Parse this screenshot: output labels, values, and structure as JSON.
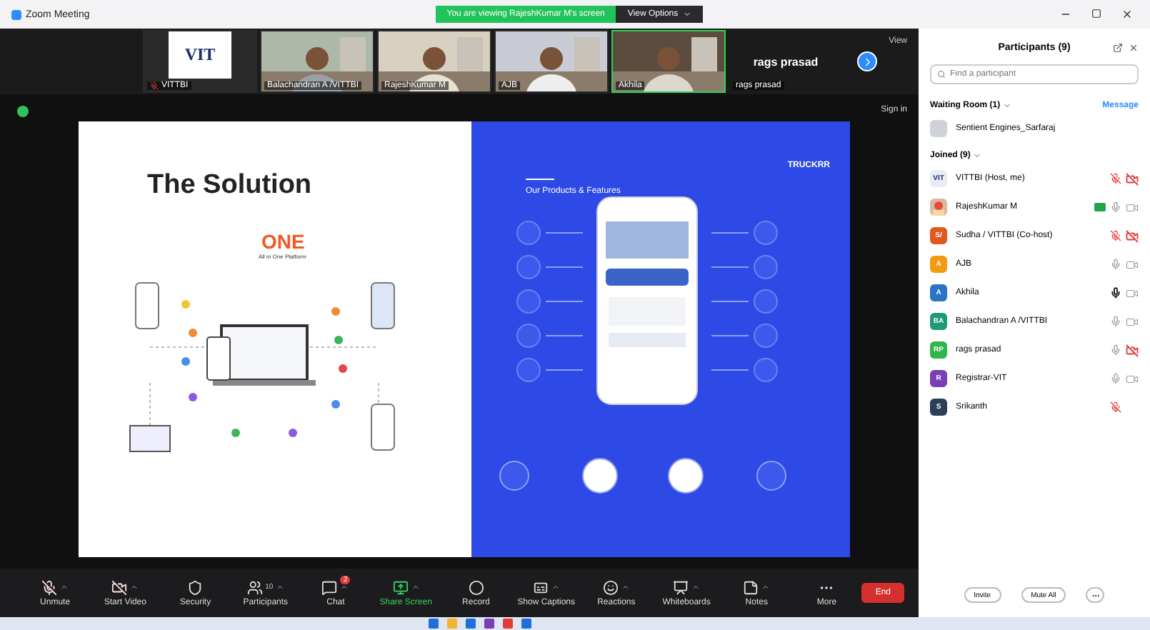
{
  "window": {
    "title": "Zoom Meeting"
  },
  "share_banner": {
    "text": "You are viewing RajeshKumar M's screen",
    "options": "View Options"
  },
  "video_strip": {
    "tiles": [
      {
        "kind": "logo",
        "logo": "VIT",
        "name": "VITTBI",
        "muted": true
      },
      {
        "kind": "video",
        "name": "Balachandran A /VITTBI",
        "muted": false,
        "speaking": false
      },
      {
        "kind": "video",
        "name": "RajeshKumar M",
        "muted": false,
        "speaking": false
      },
      {
        "kind": "video",
        "name": "AJB",
        "muted": false,
        "speaking": false
      },
      {
        "kind": "video",
        "name": "Akhila",
        "muted": false,
        "speaking": true
      },
      {
        "kind": "name",
        "display": "rags prasad",
        "name": "rags prasad",
        "muted": false
      }
    ],
    "view_label": "View"
  },
  "share": {
    "sign_in": "Sign in",
    "slide": {
      "title": "The Solution",
      "one": "ONE",
      "one_sub": "All in One Platform",
      "right_heading": "Our Products & Features",
      "brand": "TRUCKRR"
    }
  },
  "toolbar": {
    "buttons": [
      {
        "kind": "mic",
        "label": "Unmute",
        "off": true
      },
      {
        "kind": "video",
        "label": "Start Video",
        "off": true
      },
      {
        "kind": "security",
        "label": "Security"
      },
      {
        "kind": "participants",
        "label": "Participants",
        "count": "10"
      },
      {
        "kind": "chat",
        "label": "Chat",
        "badge": "2"
      },
      {
        "kind": "share",
        "label": "Share Screen"
      },
      {
        "kind": "record",
        "label": "Record"
      },
      {
        "kind": "captions",
        "label": "Show Captions"
      },
      {
        "kind": "reactions",
        "label": "Reactions"
      },
      {
        "kind": "whiteboards",
        "label": "Whiteboards"
      },
      {
        "kind": "notes",
        "label": "Notes"
      },
      {
        "kind": "more",
        "label": "More"
      }
    ],
    "end": "End"
  },
  "participants_panel": {
    "title": "Participants (9)",
    "search": {
      "placeholder": "Find a participant"
    },
    "waiting_room": {
      "label": "Waiting Room (1)",
      "message": "Message",
      "people": [
        {
          "name": "Sentient Engines_Sarfaraj"
        }
      ]
    },
    "joined": {
      "label": "Joined (9)",
      "people": [
        {
          "name": "VITTBI (Host, me)",
          "kind": "logo",
          "initials": "VIT",
          "color": "#e8ecf5",
          "muted": true,
          "speaking": false,
          "video_shown": true,
          "video_off": true,
          "sharing": false
        },
        {
          "name": "RajeshKumar M",
          "kind": "picture",
          "color": "#d9b8a0",
          "muted": false,
          "speaking": false,
          "video_shown": true,
          "video_off": false,
          "sharing": true
        },
        {
          "name": "Sudha / VITTBI (Co-host)",
          "kind": "initials",
          "initials": "S/",
          "color": "#e0591f",
          "muted": true,
          "speaking": false,
          "video_shown": true,
          "video_off": true,
          "sharing": false
        },
        {
          "name": "AJB",
          "kind": "initials",
          "initials": "A",
          "color": "#f39a12",
          "muted": false,
          "speaking": false,
          "video_shown": true,
          "video_off": false,
          "sharing": false
        },
        {
          "name": "Akhila",
          "kind": "initials",
          "initials": "A",
          "color": "#2a73c5",
          "muted": false,
          "speaking": true,
          "video_shown": true,
          "video_off": false,
          "sharing": false
        },
        {
          "name": "Balachandran A /VITTBI",
          "kind": "initials",
          "initials": "BA",
          "color": "#1c9a7a",
          "muted": false,
          "speaking": false,
          "video_shown": true,
          "video_off": false,
          "sharing": false
        },
        {
          "name": "rags prasad",
          "kind": "initials",
          "initials": "RP",
          "color": "#2fb54a",
          "muted": false,
          "speaking": false,
          "video_shown": true,
          "video_off": true,
          "sharing": false
        },
        {
          "name": "Registrar-VIT",
          "kind": "initials",
          "initials": "R",
          "color": "#7b3fb5",
          "muted": false,
          "speaking": false,
          "video_shown": true,
          "video_off": false,
          "sharing": false
        },
        {
          "name": "Srikanth",
          "kind": "initials",
          "initials": "S",
          "color": "#2c3e5a",
          "muted": true,
          "speaking": false,
          "video_shown": false,
          "sharing": false
        }
      ]
    },
    "buttons": [
      "Invite",
      "Mute All"
    ]
  }
}
